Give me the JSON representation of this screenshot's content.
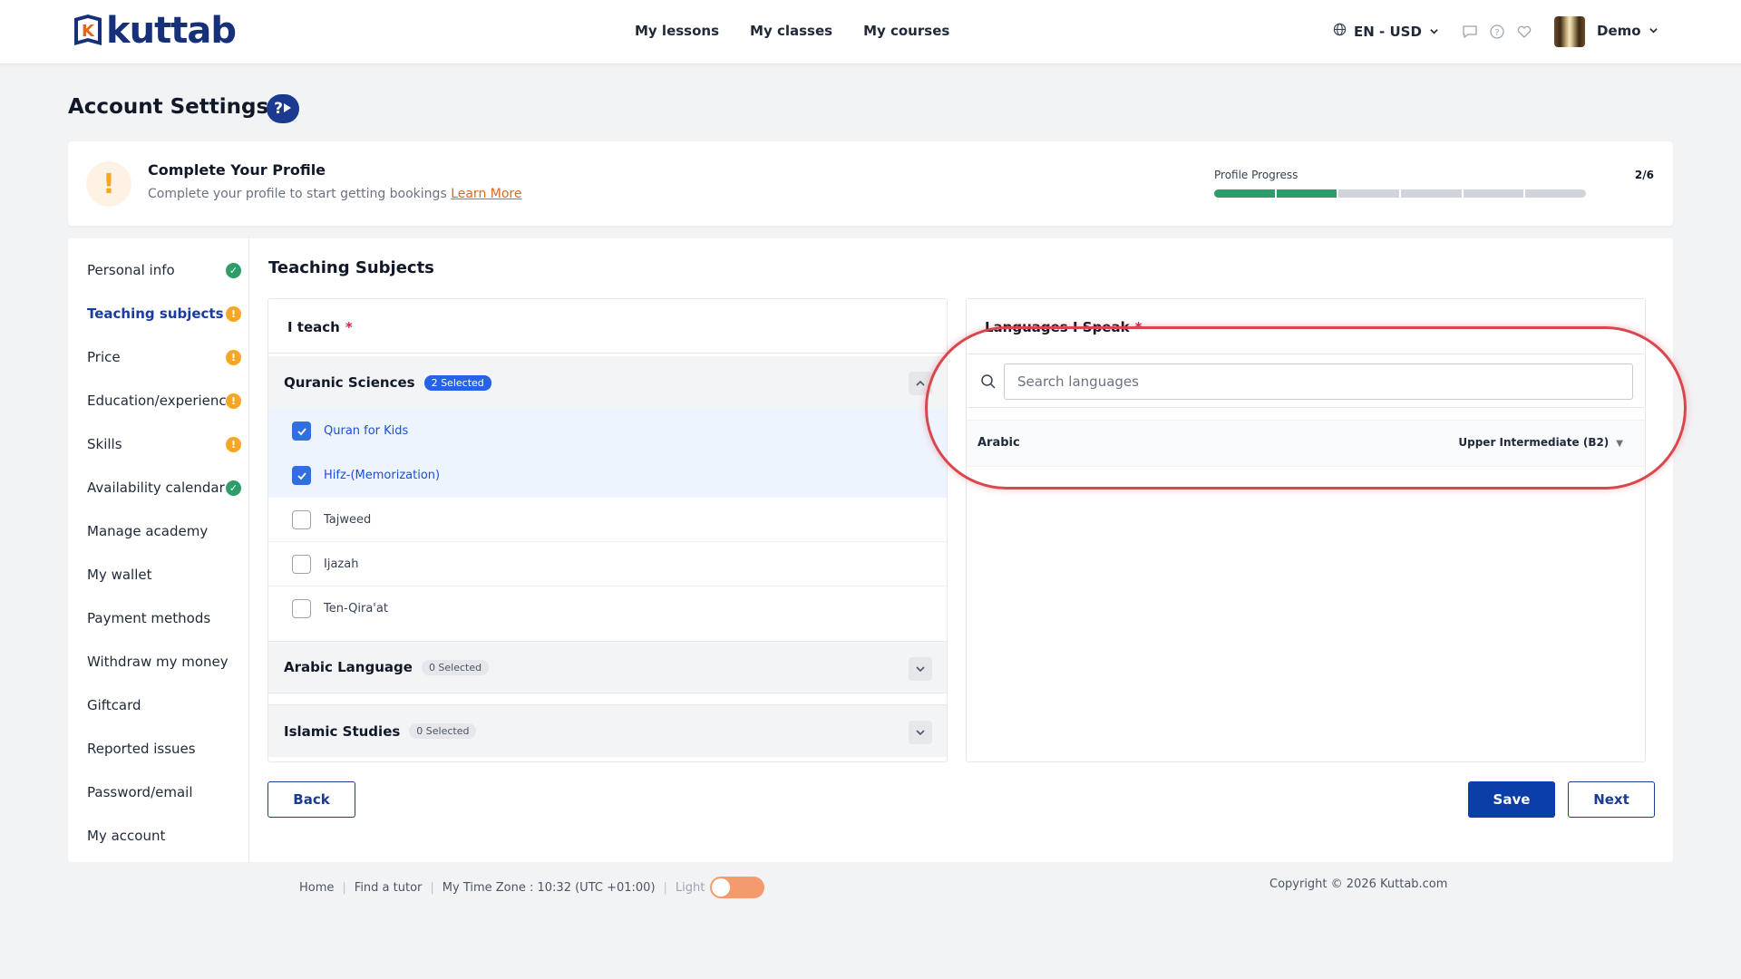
{
  "header": {
    "logo_text": "kuttab",
    "nav": [
      "My lessons",
      "My classes",
      "My courses"
    ],
    "lang_currency": "EN - USD",
    "user_name": "Demo"
  },
  "page": {
    "title": "Account Settings",
    "help_badge": "?"
  },
  "profile": {
    "title": "Complete Your Profile",
    "subtitle": "Complete your profile to start getting bookings",
    "learn_more": "Learn More",
    "progress_label": "Profile Progress",
    "progress_count": "2/6",
    "progress_done": 2,
    "progress_total": 6,
    "colors": {
      "done": "#2e9d6a",
      "pending": "#d1d5db",
      "warning": "#f5a623"
    }
  },
  "sidebar": {
    "items": [
      {
        "label": "Personal info",
        "status": "ok"
      },
      {
        "label": "Teaching subjects",
        "status": "warn",
        "active": true
      },
      {
        "label": "Price",
        "status": "warn"
      },
      {
        "label": "Education/experience",
        "status": "warn"
      },
      {
        "label": "Skills",
        "status": "warn"
      },
      {
        "label": "Availability calendar",
        "status": "ok"
      },
      {
        "label": "Manage academy"
      },
      {
        "label": "My wallet"
      },
      {
        "label": "Payment methods"
      },
      {
        "label": "Withdraw my money"
      },
      {
        "label": "Giftcard"
      },
      {
        "label": "Reported issues"
      },
      {
        "label": "Password/email"
      },
      {
        "label": "My account"
      }
    ]
  },
  "main": {
    "section_title": "Teaching Subjects",
    "teach": {
      "label": "I teach",
      "required": "*",
      "groups": [
        {
          "name": "Quranic Sciences",
          "badge": "2 Selected",
          "expanded": true,
          "subjects": [
            {
              "label": "Quran for Kids",
              "checked": true
            },
            {
              "label": "Hifz-(Memorization)",
              "checked": true
            },
            {
              "label": "Tajweed",
              "checked": false
            },
            {
              "label": "Ijazah",
              "checked": false
            },
            {
              "label": "Ten-Qira'at",
              "checked": false
            }
          ]
        },
        {
          "name": "Arabic Language",
          "badge": "0 Selected",
          "expanded": false
        },
        {
          "name": "Islamic Studies",
          "badge": "0 Selected",
          "expanded": false
        }
      ]
    },
    "languages": {
      "label": "Languages I Speak",
      "required": "*",
      "search_placeholder": "Search languages",
      "items": [
        {
          "name": "Arabic",
          "level": "Upper Intermediate (B2)"
        }
      ]
    },
    "buttons": {
      "back": "Back",
      "save": "Save",
      "next": "Next"
    }
  },
  "footer": {
    "home": "Home",
    "find_tutor": "Find a tutor",
    "timezone": "My Time Zone : 10:32 (UTC +01:00)",
    "theme_label": "Light",
    "copyright": "Copyright © 2026 Kuttab.com"
  }
}
